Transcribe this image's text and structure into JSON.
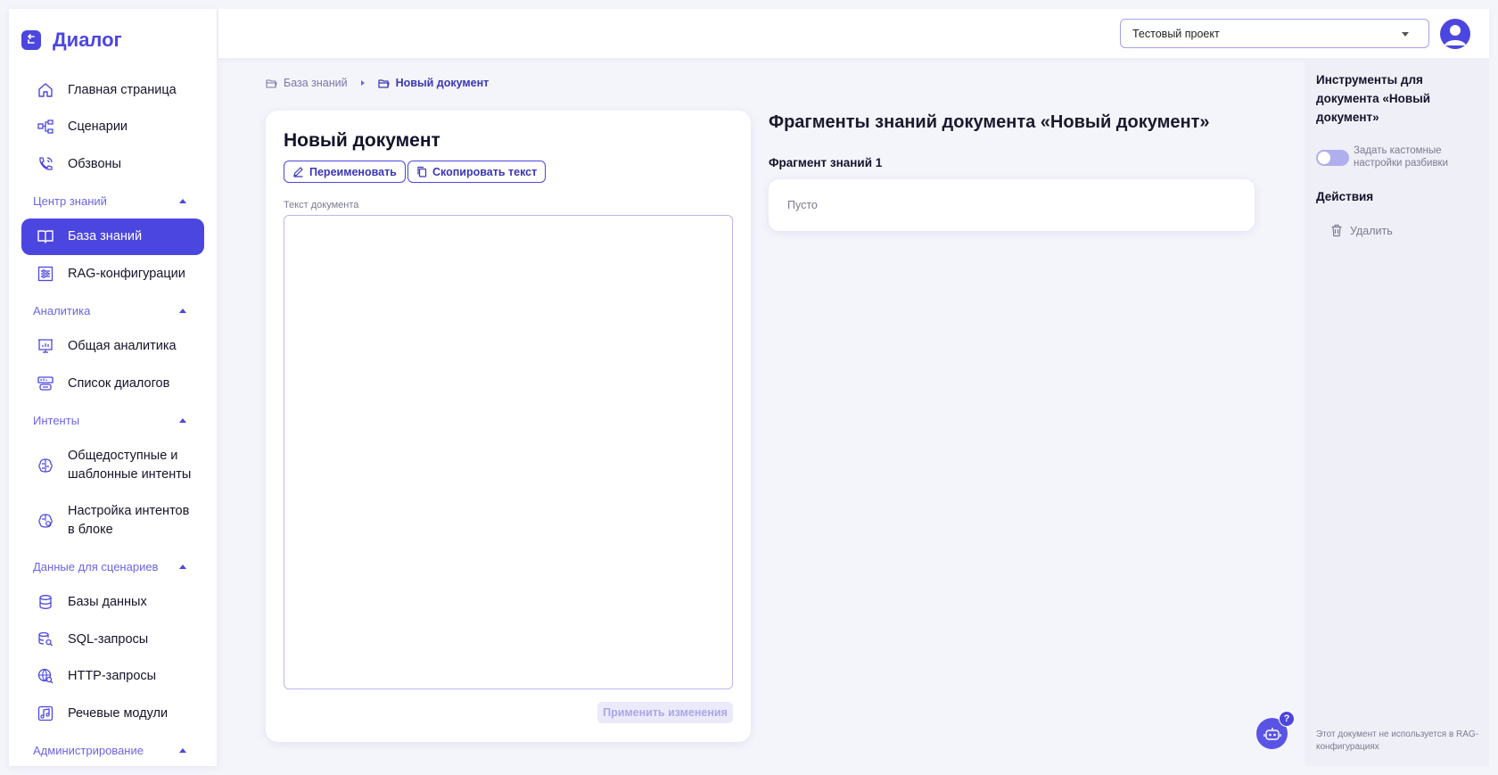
{
  "app": {
    "title": "Диалог",
    "brand_color": "#4c46e0"
  },
  "sidebar": {
    "top_items": [
      {
        "label": "Главная страница",
        "icon": "home-icon"
      },
      {
        "label": "Сценарии",
        "icon": "scenario-icon"
      },
      {
        "label": "Обзвоны",
        "icon": "phone-call-icon"
      }
    ],
    "groups": [
      {
        "title": "Центр знаний",
        "items": [
          {
            "label": "База знаний",
            "icon": "book-icon",
            "active": true
          },
          {
            "label": "RAG-конфигурации",
            "icon": "sliders-icon"
          }
        ]
      },
      {
        "title": "Аналитика",
        "items": [
          {
            "label": "Общая аналитика",
            "icon": "presentation-chart-icon"
          },
          {
            "label": "Список диалогов",
            "icon": "dialog-list-icon"
          }
        ]
      },
      {
        "title": "Интенты",
        "items": [
          {
            "label": "Общедоступные и",
            "label2": "шаблонные интенты",
            "icon": "brain-icon"
          },
          {
            "label": "Настройка интентов",
            "label2": "в блоке",
            "icon": "brain-gear-icon"
          }
        ]
      },
      {
        "title": "Данные для сценариев",
        "items": [
          {
            "label": "Базы данных",
            "icon": "database-icon"
          },
          {
            "label": "SQL-запросы",
            "icon": "database-search-icon"
          },
          {
            "label": "HTTP-запросы",
            "icon": "globe-search-icon"
          },
          {
            "label": "Речевые модули",
            "icon": "music-note-icon"
          }
        ]
      },
      {
        "title": "Администрирование",
        "items": []
      }
    ]
  },
  "topbar": {
    "project_selected": "Тестовый проект"
  },
  "breadcrumb": {
    "root": "База знаний",
    "current": "Новый документ"
  },
  "document": {
    "title": "Новый документ",
    "rename_label": "Переименовать",
    "copy_label": "Скопировать текст",
    "text_label": "Текст документа",
    "text_value": "",
    "apply_label": "Применить изменения"
  },
  "fragments": {
    "heading_prefix": "Фрагменты знаний документа «",
    "heading_doc": "Новый документ",
    "heading_suffix": "»",
    "items": [
      {
        "label": "Фрагмент знаний 1",
        "content": "Пусто"
      }
    ]
  },
  "tools": {
    "title": "Инструменты для документа «Новый документ»",
    "toggle_label": "Задать кастомные настройки разбивки",
    "toggle_on": false,
    "actions_title": "Действия",
    "delete_label": "Удалить",
    "note": "Этот документ не используется в RAG-конфигурациях"
  },
  "help": {
    "badge": "?"
  }
}
